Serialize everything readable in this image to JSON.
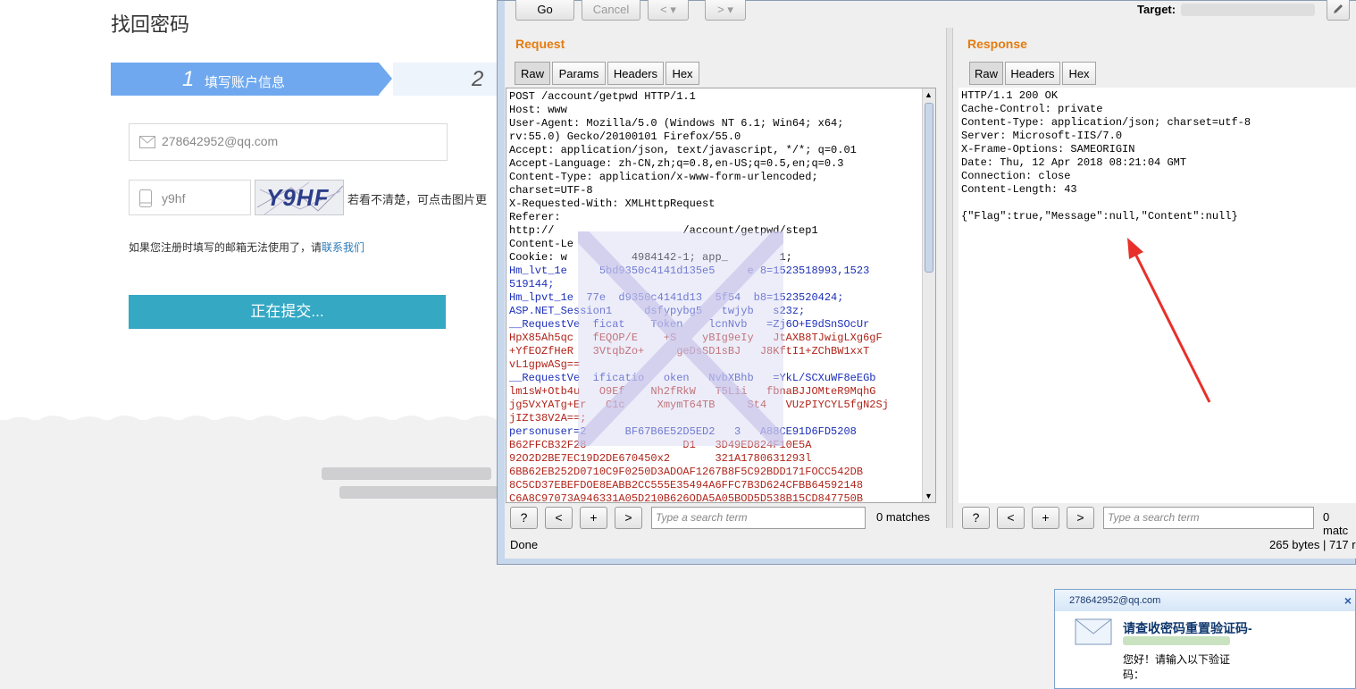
{
  "page": {
    "title": "找回密码",
    "steps": [
      {
        "num": "1",
        "label": "填写账户信息"
      },
      {
        "num": "2",
        "label": ""
      }
    ],
    "email_value": "278642952@qq.com",
    "captcha_value": "y9hf",
    "captcha_code": "Y9HF",
    "captcha_hint": "若看不清楚，可点击图片更",
    "note_text": "如果您注册时填写的邮箱无法使用了，请",
    "note_link": "联系我们",
    "submit_label": "正在提交..."
  },
  "burp": {
    "toolbar": {
      "go": "Go",
      "cancel": "Cancel",
      "back": "<",
      "forward": ">",
      "target_label": "Target:",
      "dropdown": "▾"
    },
    "request": {
      "title": "Request",
      "tabs": [
        "Raw",
        "Params",
        "Headers",
        "Hex"
      ],
      "lines": [
        {
          "t": "POST /account/getpwd HTTP/1.1",
          "c": "k"
        },
        {
          "t": "Host: www",
          "c": "k"
        },
        {
          "t": "User-Agent: Mozilla/5.0 (Windows NT 6.1; Win64; x64;",
          "c": "k"
        },
        {
          "t": "rv:55.0) Gecko/20100101 Firefox/55.0",
          "c": "k"
        },
        {
          "t": "Accept: application/json, text/javascript, */*; q=0.01",
          "c": "k"
        },
        {
          "t": "Accept-Language: zh-CN,zh;q=0.8,en-US;q=0.5,en;q=0.3",
          "c": "k"
        },
        {
          "t": "Content-Type: application/x-www-form-urlencoded;",
          "c": "k"
        },
        {
          "t": "charset=UTF-8",
          "c": "k"
        },
        {
          "t": "X-Requested-With: XMLHttpRequest",
          "c": "k"
        },
        {
          "t": "Referer:",
          "c": "k"
        },
        {
          "t": "http://                    /account/getpwd/step1",
          "c": "k"
        },
        {
          "t": "Content-Le",
          "c": "k"
        },
        {
          "t": "Cookie: w          4984142-1; app_        1;",
          "c": "k"
        },
        {
          "t": "Hm_lvt_1e     5bd9350c4141d135e5     e 8=1523518993,1523",
          "c": "blue"
        },
        {
          "t": "519144;",
          "c": "blue"
        },
        {
          "t": "Hm_lpvt_1e  77e  d9350c4141d13  5f54  b8=1523520424;",
          "c": "blue"
        },
        {
          "t": "ASP.NET_Session1     dsfypybg5   twjyb   s23z;",
          "c": "blue"
        },
        {
          "t": "__RequestVe  ficat    Token    lcnNvb   =Zj6O+E9dSnSOcUr",
          "c": "blue"
        },
        {
          "t": "HpX85Ah5qc   fEQOP/E    +S    yBIg9eIy   JtAXB8TJwigLXg6gF",
          "c": "red"
        },
        {
          "t": "+YfEOZfHeR   3VtqbZo+     geDsSD1sBJ   J8KftI1+ZChBW1xxT",
          "c": "red"
        },
        {
          "t": "vL1gpwASg==",
          "c": "red"
        },
        {
          "t": "__RequestVe  ificatio   oken   NvbXBhb   =YkL/SCXuWF8eEGb",
          "c": "blue"
        },
        {
          "t": "lm1sW+Otb4u   O9Ef    Nh2fRkW   T5Lii   fbnaBJJOMteR9MqhG",
          "c": "red"
        },
        {
          "t": "jg5VxYATg+Er   C1c     XmymT64TB     St4   VUzPIYCYL5fgN2Sj",
          "c": "red"
        },
        {
          "t": "jIZt38V2A==;",
          "c": "red"
        },
        {
          "t": "personuser=2      BF67B6E52D5ED2   3   A88CE91D6FD5208",
          "c": "blue"
        },
        {
          "t": "B62FFCB32F28               D1   3D49ED824F10E5A",
          "c": "red"
        },
        {
          "t": "92O2D2BE7EC19D2DE670450x2       321A1780631293l",
          "c": "red"
        },
        {
          "t": "6BB62EB252D0710C9F0250D3ADOAF1267B8F5C92BDD171FOCC542DB",
          "c": "red"
        },
        {
          "t": "8C5CD37EBEFDOE8EABB2CC555E35494A6FFC7B3D624CFBB64592148",
          "c": "red"
        },
        {
          "t": "C6A8C97073A946331A05D210B626ODA5A05BOD5D538B15CD847750B",
          "c": "red"
        }
      ],
      "search_placeholder": "Type a search term",
      "matches": "0 matches",
      "status": "Done"
    },
    "response": {
      "title": "Response",
      "tabs": [
        "Raw",
        "Headers",
        "Hex"
      ],
      "lines": [
        "HTTP/1.1 200 OK",
        "Cache-Control: private",
        "Content-Type: application/json; charset=utf-8",
        "Server: Microsoft-IIS/7.0",
        "X-Frame-Options: SAMEORIGIN",
        "Date: Thu, 12 Apr 2018 08:21:04 GMT",
        "Connection: close",
        "Content-Length: 43",
        "",
        "{\"Flag\":true,\"Message\":null,\"Content\":null}"
      ],
      "search_placeholder": "Type a search term",
      "matches": "0 matc",
      "status": "265 bytes | 717 r"
    },
    "search_buttons": [
      "?",
      "<",
      "+",
      ">"
    ]
  },
  "notification": {
    "from": "278642952@qq.com",
    "close": "×",
    "subject": "请查收密码重置验证码-",
    "body_line1": "您好！请输入以下验证",
    "body_line2": "码："
  },
  "colors": {
    "step_active": "#6fa8ee",
    "submit": "#35a8c4",
    "burp_title": "#e47c10",
    "arrow": "#e8302a"
  }
}
